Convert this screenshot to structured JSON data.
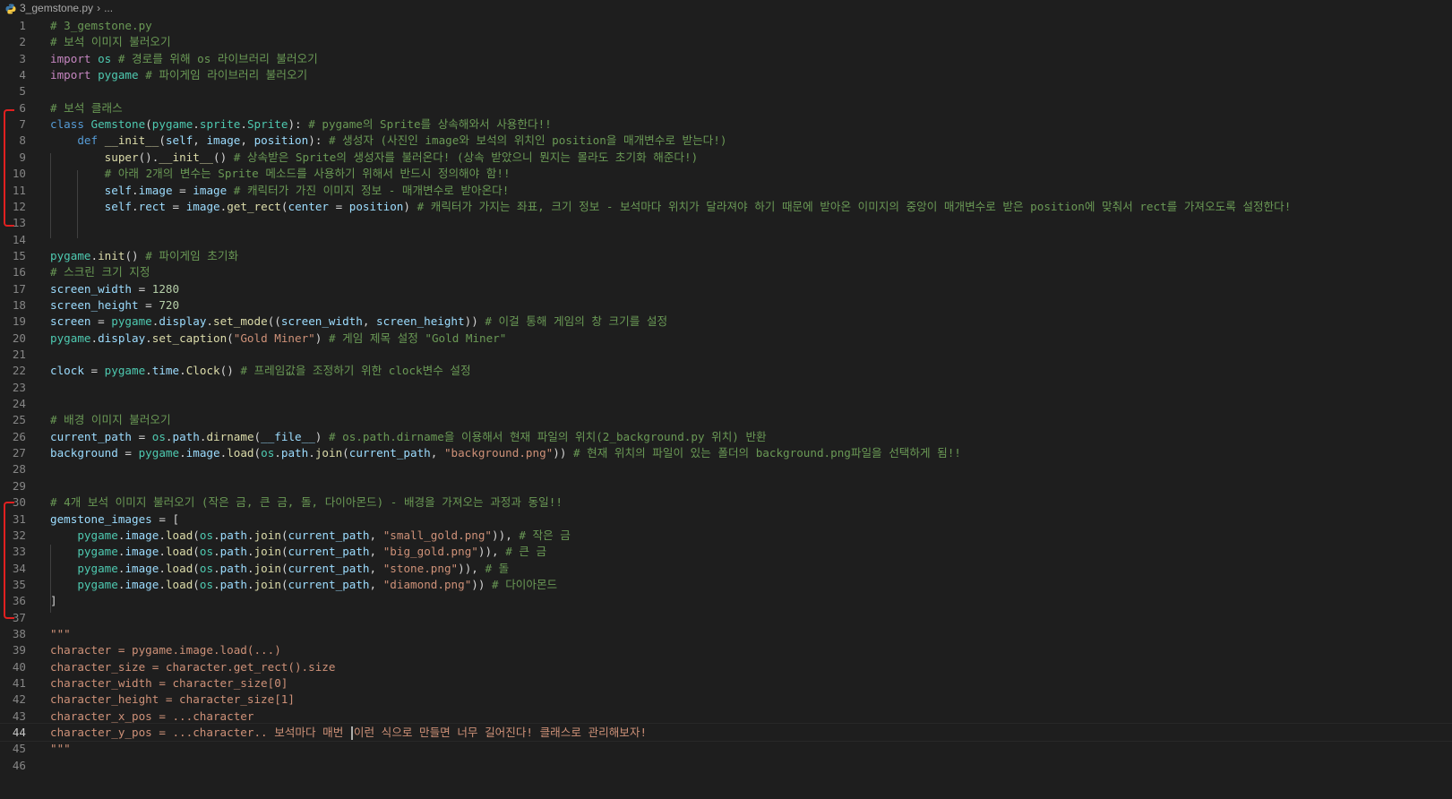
{
  "breadcrumb": {
    "file": "3_gemstone.py",
    "trail": "..."
  },
  "editor": {
    "lines": [
      {
        "n": "1",
        "segs": [
          [
            "cmt",
            "# 3_gemstone.py"
          ]
        ]
      },
      {
        "n": "2",
        "segs": [
          [
            "cmt",
            "# 보석 이미지 불러오기"
          ]
        ]
      },
      {
        "n": "3",
        "segs": [
          [
            "kw",
            "import"
          ],
          [
            "op",
            " "
          ],
          [
            "cls",
            "os"
          ],
          [
            "op",
            " "
          ],
          [
            "cmt",
            "# 경로를 위해 os 라이브러리 불러오기"
          ]
        ]
      },
      {
        "n": "4",
        "segs": [
          [
            "kw",
            "import"
          ],
          [
            "op",
            " "
          ],
          [
            "cls",
            "pygame"
          ],
          [
            "op",
            " "
          ],
          [
            "cmt",
            "# 파이게임 라이브러리 불러오기"
          ]
        ]
      },
      {
        "n": "5",
        "segs": []
      },
      {
        "n": "6",
        "segs": [
          [
            "cmt",
            "# 보석 클래스"
          ]
        ]
      },
      {
        "n": "7",
        "segs": [
          [
            "kwb",
            "class"
          ],
          [
            "op",
            " "
          ],
          [
            "cls",
            "Gemstone"
          ],
          [
            "op",
            "("
          ],
          [
            "cls",
            "pygame"
          ],
          [
            "op",
            "."
          ],
          [
            "cls",
            "sprite"
          ],
          [
            "op",
            "."
          ],
          [
            "cls",
            "Sprite"
          ],
          [
            "op",
            "): "
          ],
          [
            "cmt",
            "# pygame의 Sprite를 상속해와서 사용한다!!"
          ]
        ]
      },
      {
        "n": "8",
        "segs": [
          [
            "op",
            "    "
          ],
          [
            "kwb",
            "def"
          ],
          [
            "op",
            " "
          ],
          [
            "fn",
            "__init__"
          ],
          [
            "op",
            "("
          ],
          [
            "var",
            "self"
          ],
          [
            "op",
            ", "
          ],
          [
            "var",
            "image"
          ],
          [
            "op",
            ", "
          ],
          [
            "var",
            "position"
          ],
          [
            "op",
            "): "
          ],
          [
            "cmt",
            "# 생성자 (사진인 image와 보석의 위치인 position을 매개변수로 받는다!)"
          ]
        ]
      },
      {
        "n": "9",
        "segs": [
          [
            "op",
            "        "
          ],
          [
            "fn",
            "super"
          ],
          [
            "op",
            "()."
          ],
          [
            "fn",
            "__init__"
          ],
          [
            "op",
            "() "
          ],
          [
            "cmt",
            "# 상속받은 Sprite의 생성자를 불러온다! (상속 받았으니 뭔지는 몰라도 초기화 해준다!)"
          ]
        ]
      },
      {
        "n": "10",
        "segs": [
          [
            "op",
            "        "
          ],
          [
            "cmt",
            "# 아래 2개의 변수는 Sprite 메소드를 사용하기 위해서 반드시 정의해야 함!!"
          ]
        ]
      },
      {
        "n": "11",
        "segs": [
          [
            "op",
            "        "
          ],
          [
            "var",
            "self"
          ],
          [
            "op",
            "."
          ],
          [
            "var",
            "image"
          ],
          [
            "op",
            " = "
          ],
          [
            "var",
            "image"
          ],
          [
            "op",
            " "
          ],
          [
            "cmt",
            "# 캐릭터가 가진 이미지 정보 - 매개변수로 받아온다!"
          ]
        ]
      },
      {
        "n": "12",
        "segs": [
          [
            "op",
            "        "
          ],
          [
            "var",
            "self"
          ],
          [
            "op",
            "."
          ],
          [
            "var",
            "rect"
          ],
          [
            "op",
            " = "
          ],
          [
            "var",
            "image"
          ],
          [
            "op",
            "."
          ],
          [
            "fn",
            "get_rect"
          ],
          [
            "op",
            "("
          ],
          [
            "var",
            "center"
          ],
          [
            "op",
            " = "
          ],
          [
            "var",
            "position"
          ],
          [
            "op",
            ") "
          ],
          [
            "cmt",
            "# 캐릭터가 가지는 좌표, 크기 정보 - 보석마다 위치가 달라져야 하기 때문에 받아온 이미지의 중앙이 매개변수로 받은 position에 맞춰서 rect를 가져오도록 설정한다!"
          ]
        ]
      },
      {
        "n": "13",
        "segs": []
      },
      {
        "n": "14",
        "segs": []
      },
      {
        "n": "15",
        "segs": [
          [
            "cls",
            "pygame"
          ],
          [
            "op",
            "."
          ],
          [
            "fn",
            "init"
          ],
          [
            "op",
            "() "
          ],
          [
            "cmt",
            "# 파이게임 초기화"
          ]
        ]
      },
      {
        "n": "16",
        "segs": [
          [
            "cmt",
            "# 스크린 크기 지정"
          ]
        ]
      },
      {
        "n": "17",
        "segs": [
          [
            "var",
            "screen_width"
          ],
          [
            "op",
            " = "
          ],
          [
            "num",
            "1280"
          ]
        ]
      },
      {
        "n": "18",
        "segs": [
          [
            "var",
            "screen_height"
          ],
          [
            "op",
            " = "
          ],
          [
            "num",
            "720"
          ]
        ]
      },
      {
        "n": "19",
        "segs": [
          [
            "var",
            "screen"
          ],
          [
            "op",
            " = "
          ],
          [
            "cls",
            "pygame"
          ],
          [
            "op",
            "."
          ],
          [
            "var",
            "display"
          ],
          [
            "op",
            "."
          ],
          [
            "fn",
            "set_mode"
          ],
          [
            "op",
            "(("
          ],
          [
            "var",
            "screen_width"
          ],
          [
            "op",
            ", "
          ],
          [
            "var",
            "screen_height"
          ],
          [
            "op",
            ")) "
          ],
          [
            "cmt",
            "# 이걸 통해 게임의 창 크기를 설정"
          ]
        ]
      },
      {
        "n": "20",
        "segs": [
          [
            "cls",
            "pygame"
          ],
          [
            "op",
            "."
          ],
          [
            "var",
            "display"
          ],
          [
            "op",
            "."
          ],
          [
            "fn",
            "set_caption"
          ],
          [
            "op",
            "("
          ],
          [
            "str",
            "\"Gold Miner\""
          ],
          [
            "op",
            ") "
          ],
          [
            "cmt",
            "# 게임 제목 설정 \"Gold Miner\""
          ]
        ]
      },
      {
        "n": "21",
        "segs": []
      },
      {
        "n": "22",
        "segs": [
          [
            "var",
            "clock"
          ],
          [
            "op",
            " = "
          ],
          [
            "cls",
            "pygame"
          ],
          [
            "op",
            "."
          ],
          [
            "var",
            "time"
          ],
          [
            "op",
            "."
          ],
          [
            "fn",
            "Clock"
          ],
          [
            "op",
            "() "
          ],
          [
            "cmt",
            "# 프레임값을 조정하기 위한 clock변수 설정"
          ]
        ]
      },
      {
        "n": "23",
        "segs": []
      },
      {
        "n": "24",
        "segs": []
      },
      {
        "n": "25",
        "segs": [
          [
            "cmt",
            "# 배경 이미지 불러오기"
          ]
        ]
      },
      {
        "n": "26",
        "segs": [
          [
            "var",
            "current_path"
          ],
          [
            "op",
            " = "
          ],
          [
            "cls",
            "os"
          ],
          [
            "op",
            "."
          ],
          [
            "var",
            "path"
          ],
          [
            "op",
            "."
          ],
          [
            "fn",
            "dirname"
          ],
          [
            "op",
            "("
          ],
          [
            "var",
            "__file__"
          ],
          [
            "op",
            ") "
          ],
          [
            "cmt",
            "# os.path.dirname을 이용해서 현재 파일의 위치(2_background.py 위치) 반환"
          ]
        ]
      },
      {
        "n": "27",
        "segs": [
          [
            "var",
            "background"
          ],
          [
            "op",
            " = "
          ],
          [
            "cls",
            "pygame"
          ],
          [
            "op",
            "."
          ],
          [
            "var",
            "image"
          ],
          [
            "op",
            "."
          ],
          [
            "fn",
            "load"
          ],
          [
            "op",
            "("
          ],
          [
            "cls",
            "os"
          ],
          [
            "op",
            "."
          ],
          [
            "var",
            "path"
          ],
          [
            "op",
            "."
          ],
          [
            "fn",
            "join"
          ],
          [
            "op",
            "("
          ],
          [
            "var",
            "current_path"
          ],
          [
            "op",
            ", "
          ],
          [
            "str",
            "\"background.png\""
          ],
          [
            "op",
            ")) "
          ],
          [
            "cmt",
            "# 현재 위치의 파일이 있는 폴더의 background.png파일을 선택하게 됨!!"
          ]
        ]
      },
      {
        "n": "28",
        "segs": []
      },
      {
        "n": "29",
        "segs": []
      },
      {
        "n": "30",
        "segs": [
          [
            "cmt",
            "# 4개 보석 이미지 불러오기 (작은 금, 큰 금, 돌, 다이아몬드) - 배경을 가져오는 과정과 동일!!"
          ]
        ]
      },
      {
        "n": "31",
        "segs": [
          [
            "var",
            "gemstone_images"
          ],
          [
            "op",
            " = ["
          ]
        ]
      },
      {
        "n": "32",
        "segs": [
          [
            "op",
            "    "
          ],
          [
            "cls",
            "pygame"
          ],
          [
            "op",
            "."
          ],
          [
            "var",
            "image"
          ],
          [
            "op",
            "."
          ],
          [
            "fn",
            "load"
          ],
          [
            "op",
            "("
          ],
          [
            "cls",
            "os"
          ],
          [
            "op",
            "."
          ],
          [
            "var",
            "path"
          ],
          [
            "op",
            "."
          ],
          [
            "fn",
            "join"
          ],
          [
            "op",
            "("
          ],
          [
            "var",
            "current_path"
          ],
          [
            "op",
            ", "
          ],
          [
            "str",
            "\"small_gold.png\""
          ],
          [
            "op",
            ")), "
          ],
          [
            "cmt",
            "# 작은 금"
          ]
        ]
      },
      {
        "n": "33",
        "segs": [
          [
            "op",
            "    "
          ],
          [
            "cls",
            "pygame"
          ],
          [
            "op",
            "."
          ],
          [
            "var",
            "image"
          ],
          [
            "op",
            "."
          ],
          [
            "fn",
            "load"
          ],
          [
            "op",
            "("
          ],
          [
            "cls",
            "os"
          ],
          [
            "op",
            "."
          ],
          [
            "var",
            "path"
          ],
          [
            "op",
            "."
          ],
          [
            "fn",
            "join"
          ],
          [
            "op",
            "("
          ],
          [
            "var",
            "current_path"
          ],
          [
            "op",
            ", "
          ],
          [
            "str",
            "\"big_gold.png\""
          ],
          [
            "op",
            ")), "
          ],
          [
            "cmt",
            "# 큰 금"
          ]
        ]
      },
      {
        "n": "34",
        "segs": [
          [
            "op",
            "    "
          ],
          [
            "cls",
            "pygame"
          ],
          [
            "op",
            "."
          ],
          [
            "var",
            "image"
          ],
          [
            "op",
            "."
          ],
          [
            "fn",
            "load"
          ],
          [
            "op",
            "("
          ],
          [
            "cls",
            "os"
          ],
          [
            "op",
            "."
          ],
          [
            "var",
            "path"
          ],
          [
            "op",
            "."
          ],
          [
            "fn",
            "join"
          ],
          [
            "op",
            "("
          ],
          [
            "var",
            "current_path"
          ],
          [
            "op",
            ", "
          ],
          [
            "str",
            "\"stone.png\""
          ],
          [
            "op",
            ")), "
          ],
          [
            "cmt",
            "# 돌"
          ]
        ]
      },
      {
        "n": "35",
        "segs": [
          [
            "op",
            "    "
          ],
          [
            "cls",
            "pygame"
          ],
          [
            "op",
            "."
          ],
          [
            "var",
            "image"
          ],
          [
            "op",
            "."
          ],
          [
            "fn",
            "load"
          ],
          [
            "op",
            "("
          ],
          [
            "cls",
            "os"
          ],
          [
            "op",
            "."
          ],
          [
            "var",
            "path"
          ],
          [
            "op",
            "."
          ],
          [
            "fn",
            "join"
          ],
          [
            "op",
            "("
          ],
          [
            "var",
            "current_path"
          ],
          [
            "op",
            ", "
          ],
          [
            "str",
            "\"diamond.png\""
          ],
          [
            "op",
            ")) "
          ],
          [
            "cmt",
            "# 다이아몬드"
          ]
        ]
      },
      {
        "n": "36",
        "segs": [
          [
            "op",
            "]"
          ]
        ]
      },
      {
        "n": "37",
        "segs": []
      },
      {
        "n": "38",
        "segs": [
          [
            "str",
            "\"\"\""
          ]
        ]
      },
      {
        "n": "39",
        "segs": [
          [
            "str",
            "character = pygame.image.load(...)"
          ]
        ]
      },
      {
        "n": "40",
        "segs": [
          [
            "str",
            "character_size = character.get_rect().size"
          ]
        ]
      },
      {
        "n": "41",
        "segs": [
          [
            "str",
            "character_width = character_size[0]"
          ]
        ]
      },
      {
        "n": "42",
        "segs": [
          [
            "str",
            "character_height = character_size[1]"
          ]
        ]
      },
      {
        "n": "43",
        "segs": [
          [
            "str",
            "character_x_pos = ...character"
          ]
        ]
      },
      {
        "n": "44",
        "current": true,
        "segs": [
          [
            "str",
            "character_y_pos = ...character.. 보석마다 매번 "
          ],
          [
            "cursor",
            ""
          ],
          [
            "str",
            "이런 식으로 만들면 너무 길어진다! 클래스로 관리해보자!"
          ]
        ]
      },
      {
        "n": "45",
        "segs": [
          [
            "str",
            "\"\"\""
          ]
        ]
      },
      {
        "n": "46",
        "segs": []
      }
    ]
  }
}
